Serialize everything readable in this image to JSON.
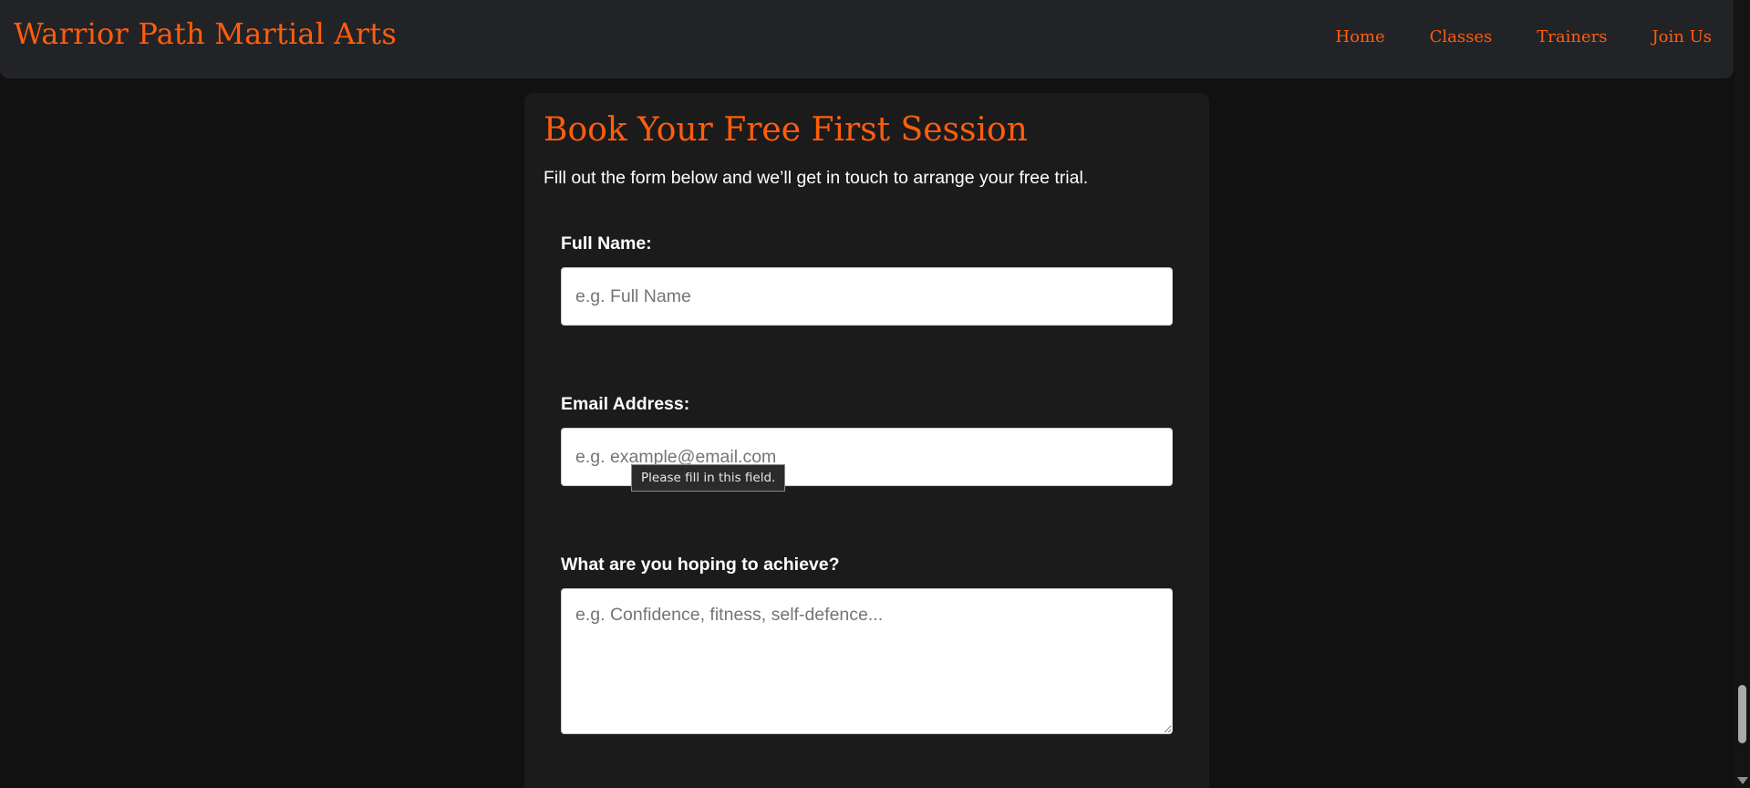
{
  "header": {
    "brand": "Warrior Path Martial Arts",
    "nav": [
      {
        "label": "Home"
      },
      {
        "label": "Classes"
      },
      {
        "label": "Trainers"
      },
      {
        "label": "Join Us"
      }
    ]
  },
  "form": {
    "title": "Book Your Free First Session",
    "subtitle": "Fill out the form below and we’ll get in touch to arrange your free trial.",
    "fields": {
      "name": {
        "label": "Full Name:",
        "placeholder": "e.g. Full Name",
        "value": ""
      },
      "email": {
        "label": "Email Address:",
        "placeholder": "e.g. example@email.com",
        "value": ""
      },
      "goal": {
        "label": "What are you hoping to achieve?",
        "placeholder": "e.g. Confidence, fitness, self-defence...",
        "value": ""
      }
    },
    "validation_tooltip": "Please fill in this field."
  },
  "colors": {
    "accent": "#ff5d0d",
    "page_background": "#111111",
    "header_background": "#222326",
    "card_background": "#1b1b1c"
  }
}
